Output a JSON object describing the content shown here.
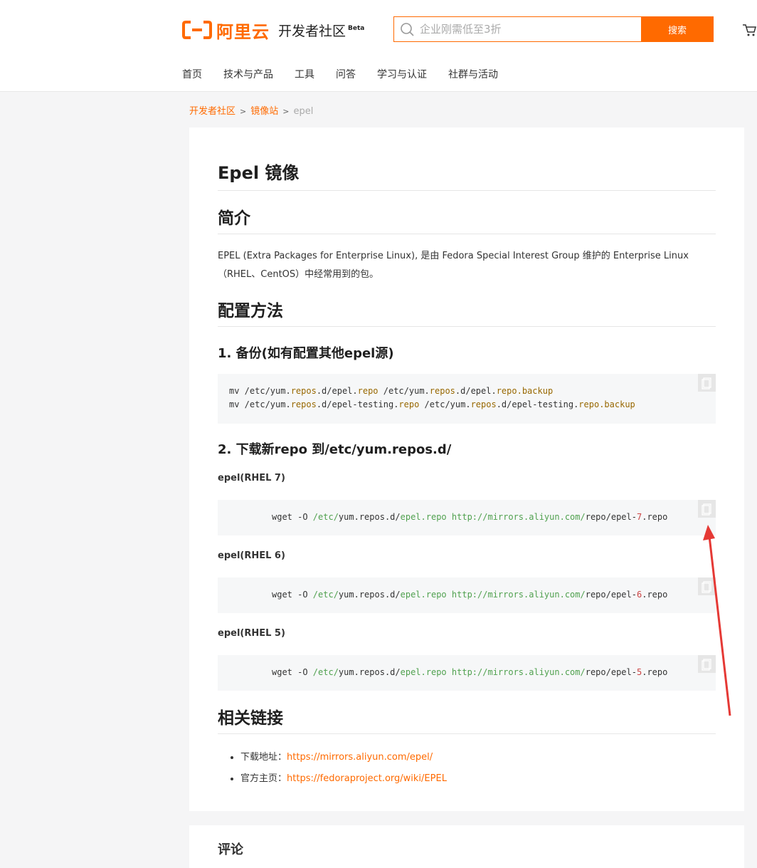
{
  "header": {
    "logo_text": "阿里云",
    "community": "开发者社区",
    "beta": "Beta",
    "search_placeholder": "企业刚需低至3折",
    "search_button": "搜索",
    "nav": [
      "首页",
      "技术与产品",
      "工具",
      "问答",
      "学习与认证",
      "社群与活动"
    ]
  },
  "breadcrumb": {
    "items": [
      "开发者社区",
      "镜像站",
      "epel"
    ],
    "separator": ">"
  },
  "article": {
    "title": "Epel 镜像",
    "intro_heading": "简介",
    "intro_text": "EPEL (Extra Packages for Enterprise Linux), 是由 Fedora Special Interest Group 维护的 Enterprise Linux（RHEL、CentOS）中经常用到的包。",
    "config_heading": "配置方法",
    "step1": "1. 备份(如有配置其他epel源)",
    "step1_code": [
      "mv /etc/yum.repos.d/epel.repo /etc/yum.repos.d/epel.repo.backup",
      "mv /etc/yum.repos.d/epel-testing.repo /etc/yum.repos.d/epel-testing.repo.backup"
    ],
    "step2": "2. 下载新repo 到/etc/yum.repos.d/",
    "variants": [
      {
        "label": "epel(RHEL 7)",
        "version": "7"
      },
      {
        "label": "epel(RHEL 6)",
        "version": "6"
      },
      {
        "label": "epel(RHEL 5)",
        "version": "5"
      }
    ],
    "wget_prefix": "wget -O ",
    "wget_dir": "/etc/",
    "wget_mid": "yum.repos.d/",
    "wget_file": "epel.repo",
    "wget_url": "http://mirrors.aliyun.com/",
    "wget_repo": "repo/epel-",
    "wget_suffix": ".repo",
    "related_heading": "相关链接",
    "links": [
      {
        "label": "下载地址：",
        "url": "https://mirrors.aliyun.com/epel/"
      },
      {
        "label": "官方主页：",
        "url": "https://fedoraproject.org/wiki/EPEL"
      }
    ]
  },
  "comments": {
    "heading": "评论"
  },
  "colors": {
    "accent": "#ff6a00",
    "annotation_arrow": "#e53935"
  }
}
